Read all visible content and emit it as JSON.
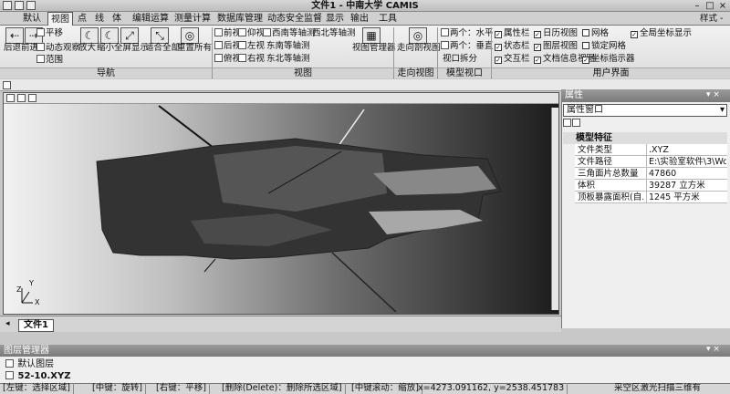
{
  "app": {
    "title": "文件1 - 中南大学 CAMIS",
    "style_label": "样式 -"
  },
  "menu": [
    "默认",
    "视图",
    "点",
    "线",
    "体",
    "编辑运算",
    "测量计算",
    "数据库管理",
    "动态安全监督",
    "显示",
    "输出",
    "工具"
  ],
  "ribbon": {
    "nav": {
      "back": "后退",
      "forward": "前进",
      "pan": "平移",
      "dynamic": "动态观察",
      "zoom_in": "放大",
      "zoom_out": "缩小",
      "fullscreen": "全屏显示",
      "fit_all": "适合全部",
      "redraw": "重置所有",
      "range": "范围",
      "group": "导航"
    },
    "view": {
      "front": "前视",
      "top": "仰视",
      "sw": "西南等轴测",
      "nw": "西北等轴测",
      "back": "后视",
      "left": "左视",
      "se": "东南等轴测",
      "bottom": "俯视",
      "right": "右视",
      "ne": "东北等轴测",
      "manager": "视图管理器",
      "group": "视图"
    },
    "dir": {
      "button": "走向剖视图",
      "group": "走向视图"
    },
    "model": {
      "h": "两个：水平",
      "v": "两个：垂直",
      "split": "视口拆分",
      "group": "模型视口"
    },
    "ui": {
      "props": "属性栏",
      "calendar": "日历视图",
      "grid": "网格",
      "global": "全局坐标显示",
      "status": "状态栏",
      "layers": "图层视图",
      "lockgrid": "锁定网格",
      "interact": "交互栏",
      "docinfo": "文档信息视图",
      "coord": "坐标指示器",
      "group": "用户界面"
    }
  },
  "doc_tab": "文件1",
  "props": {
    "title": "属性",
    "combo": "属性窗口",
    "category": "模型特征",
    "rows": [
      {
        "k": "文件类型",
        "v": ".XYZ"
      },
      {
        "k": "文件路径",
        "v": "E:\\实验室软件\\3\\Wo..."
      },
      {
        "k": "三角面片总数量",
        "v": "47860"
      },
      {
        "k": "体积",
        "v": "39287 立方米"
      },
      {
        "k": "顶板暴露面积(自...",
        "v": "1245 平方米"
      }
    ]
  },
  "layers": {
    "title": "图层管理器",
    "items": [
      "默认图层",
      "52-10.XYZ"
    ]
  },
  "status": [
    "[左键：选择区域]",
    "[中键：旋转]",
    "[右键：平移]",
    "[删除(Delete)：删除所选区域]",
    "[中键滚动：缩放]",
    "x=4273.091162, y=2538.451783",
    "采空区激光扫描三维有"
  ],
  "axis": {
    "y": "Y",
    "x": "X",
    "z": "Z"
  },
  "colors": {
    "ribbon": "#e6e6e6",
    "panel_head": "#8a8a8a"
  }
}
